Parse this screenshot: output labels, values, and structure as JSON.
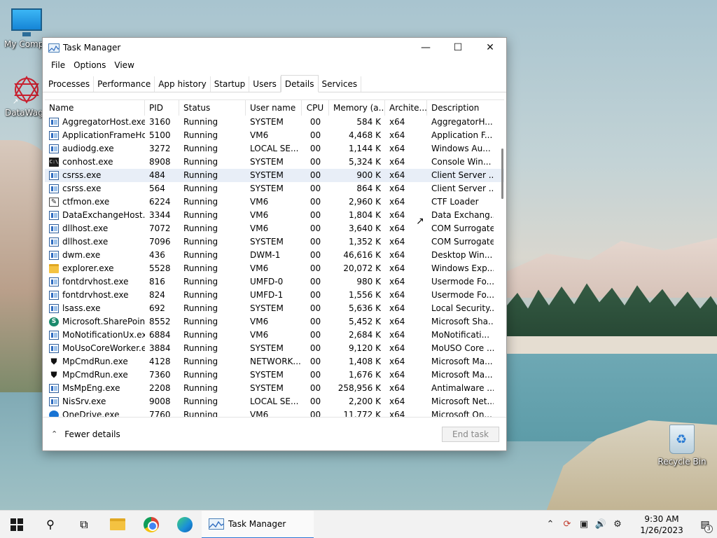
{
  "desktop": {
    "icons": [
      {
        "label": "My Compu"
      },
      {
        "label": "DataWago"
      },
      {
        "label": "Recycle Bin"
      }
    ]
  },
  "window": {
    "title": "Task Manager",
    "menu": [
      "File",
      "Options",
      "View"
    ],
    "tabs": [
      "Processes",
      "Performance",
      "App history",
      "Startup",
      "Users",
      "Details",
      "Services"
    ],
    "active_tab": "Details",
    "columns": [
      "Name",
      "PID",
      "Status",
      "User name",
      "CPU",
      "Memory (a...",
      "Archite...",
      "Description"
    ],
    "rows": [
      {
        "icon": "win",
        "name": "AggregatorHost.exe",
        "pid": "3160",
        "status": "Running",
        "user": "SYSTEM",
        "cpu": "00",
        "mem": "584 K",
        "arch": "x64",
        "desc": "AggregatorH..."
      },
      {
        "icon": "win",
        "name": "ApplicationFrameHo...",
        "pid": "5100",
        "status": "Running",
        "user": "VM6",
        "cpu": "00",
        "mem": "4,468 K",
        "arch": "x64",
        "desc": "Application F..."
      },
      {
        "icon": "win",
        "name": "audiodg.exe",
        "pid": "3272",
        "status": "Running",
        "user": "LOCAL SE...",
        "cpu": "00",
        "mem": "1,144 K",
        "arch": "x64",
        "desc": "Windows Au..."
      },
      {
        "icon": "cmd",
        "name": "conhost.exe",
        "pid": "8908",
        "status": "Running",
        "user": "SYSTEM",
        "cpu": "00",
        "mem": "5,324 K",
        "arch": "x64",
        "desc": "Console Win..."
      },
      {
        "icon": "win",
        "name": "csrss.exe",
        "pid": "484",
        "status": "Running",
        "user": "SYSTEM",
        "cpu": "00",
        "mem": "900 K",
        "arch": "x64",
        "desc": "Client Server ..."
      },
      {
        "icon": "win",
        "name": "csrss.exe",
        "pid": "564",
        "status": "Running",
        "user": "SYSTEM",
        "cpu": "00",
        "mem": "864 K",
        "arch": "x64",
        "desc": "Client Server ..."
      },
      {
        "icon": "pen",
        "name": "ctfmon.exe",
        "pid": "6224",
        "status": "Running",
        "user": "VM6",
        "cpu": "00",
        "mem": "2,960 K",
        "arch": "x64",
        "desc": "CTF Loader"
      },
      {
        "icon": "win",
        "name": "DataExchangeHost.e...",
        "pid": "3344",
        "status": "Running",
        "user": "VM6",
        "cpu": "00",
        "mem": "1,804 K",
        "arch": "x64",
        "desc": "Data Exchang..."
      },
      {
        "icon": "win",
        "name": "dllhost.exe",
        "pid": "7072",
        "status": "Running",
        "user": "VM6",
        "cpu": "00",
        "mem": "3,640 K",
        "arch": "x64",
        "desc": "COM Surrogate"
      },
      {
        "icon": "win",
        "name": "dllhost.exe",
        "pid": "7096",
        "status": "Running",
        "user": "SYSTEM",
        "cpu": "00",
        "mem": "1,352 K",
        "arch": "x64",
        "desc": "COM Surrogate"
      },
      {
        "icon": "win",
        "name": "dwm.exe",
        "pid": "436",
        "status": "Running",
        "user": "DWM-1",
        "cpu": "00",
        "mem": "46,616 K",
        "arch": "x64",
        "desc": "Desktop Win..."
      },
      {
        "icon": "folder",
        "name": "explorer.exe",
        "pid": "5528",
        "status": "Running",
        "user": "VM6",
        "cpu": "00",
        "mem": "20,072 K",
        "arch": "x64",
        "desc": "Windows Exp..."
      },
      {
        "icon": "win",
        "name": "fontdrvhost.exe",
        "pid": "816",
        "status": "Running",
        "user": "UMFD-0",
        "cpu": "00",
        "mem": "980 K",
        "arch": "x64",
        "desc": "Usermode Fo..."
      },
      {
        "icon": "win",
        "name": "fontdrvhost.exe",
        "pid": "824",
        "status": "Running",
        "user": "UMFD-1",
        "cpu": "00",
        "mem": "1,556 K",
        "arch": "x64",
        "desc": "Usermode Fo..."
      },
      {
        "icon": "win",
        "name": "lsass.exe",
        "pid": "692",
        "status": "Running",
        "user": "SYSTEM",
        "cpu": "00",
        "mem": "5,636 K",
        "arch": "x64",
        "desc": "Local Security..."
      },
      {
        "icon": "sp",
        "name": "Microsoft.SharePoin...",
        "pid": "8552",
        "status": "Running",
        "user": "VM6",
        "cpu": "00",
        "mem": "5,452 K",
        "arch": "x64",
        "desc": "Microsoft Sha..."
      },
      {
        "icon": "win",
        "name": "MoNotificationUx.exe",
        "pid": "6884",
        "status": "Running",
        "user": "VM6",
        "cpu": "00",
        "mem": "2,684 K",
        "arch": "x64",
        "desc": "MoNotificati..."
      },
      {
        "icon": "win",
        "name": "MoUsoCoreWorker.e...",
        "pid": "3884",
        "status": "Running",
        "user": "SYSTEM",
        "cpu": "00",
        "mem": "9,120 K",
        "arch": "x64",
        "desc": "MoUSO Core ..."
      },
      {
        "icon": "shield",
        "name": "MpCmdRun.exe",
        "pid": "4128",
        "status": "Running",
        "user": "NETWORK...",
        "cpu": "00",
        "mem": "1,408 K",
        "arch": "x64",
        "desc": "Microsoft Ma..."
      },
      {
        "icon": "shield",
        "name": "MpCmdRun.exe",
        "pid": "7360",
        "status": "Running",
        "user": "SYSTEM",
        "cpu": "00",
        "mem": "1,676 K",
        "arch": "x64",
        "desc": "Microsoft Ma..."
      },
      {
        "icon": "win",
        "name": "MsMpEng.exe",
        "pid": "2208",
        "status": "Running",
        "user": "SYSTEM",
        "cpu": "00",
        "mem": "258,956 K",
        "arch": "x64",
        "desc": "Antimalware ..."
      },
      {
        "icon": "win",
        "name": "NisSrv.exe",
        "pid": "9008",
        "status": "Running",
        "user": "LOCAL SE...",
        "cpu": "00",
        "mem": "2,200 K",
        "arch": "x64",
        "desc": "Microsoft Net..."
      },
      {
        "icon": "cloud",
        "name": "OneDrive.exe",
        "pid": "7760",
        "status": "Running",
        "user": "VM6",
        "cpu": "00",
        "mem": "11,772 K",
        "arch": "x64",
        "desc": "Microsoft On..."
      }
    ],
    "footer": {
      "fewer_details": "Fewer details",
      "end_task": "End task"
    }
  },
  "taskbar": {
    "active_app": "Task Manager",
    "time": "9:30 AM",
    "date": "1/26/2023",
    "notification_count": "3"
  }
}
